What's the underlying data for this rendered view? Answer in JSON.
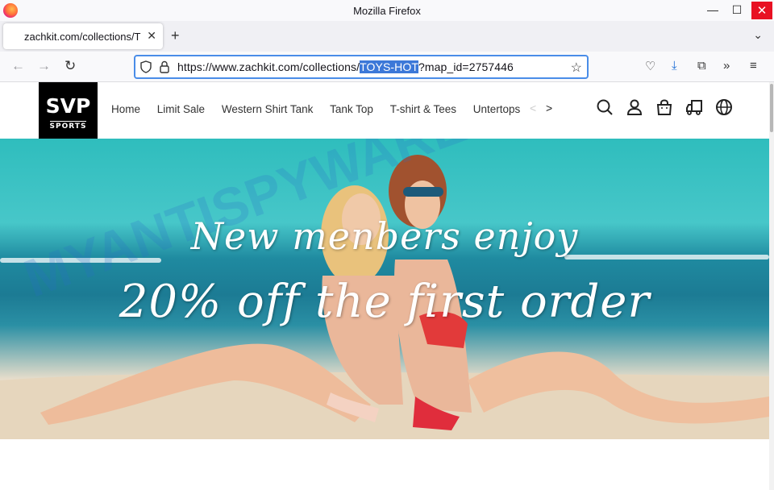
{
  "window": {
    "title": "Mozilla Firefox",
    "minimize": "—",
    "maximize": "☐",
    "close": "✕"
  },
  "tab": {
    "label": "zachkit.com/collections/T",
    "close": "✕",
    "new_tab": "+",
    "list": "⌄"
  },
  "nav": {
    "back": "←",
    "forward": "→",
    "reload": "↻",
    "url_prefix": "https://www.zachkit.com/collections/",
    "url_selected": "TOYS-HOT",
    "url_suffix": "?map_id=2757446",
    "bookmark": "☆"
  },
  "toolbar": {
    "pocket": "♡",
    "download": "⤓",
    "extensions": "⧉",
    "overflow": "»",
    "menu": "≡"
  },
  "site": {
    "logo_main": "SVP",
    "logo_sub": "SPORTS",
    "menu": [
      "Home",
      "Limit Sale",
      "Western Shirt Tank",
      "Tank Top",
      "T-shirt & Tees",
      "Untertops"
    ],
    "menu_prev": "<",
    "menu_next": ">"
  },
  "hero": {
    "line1": "New menbers enjoy",
    "line2": "20% off the first order"
  },
  "watermark": "MYANTISPYWARE.COM",
  "colors": {
    "accent": "#4a8de8",
    "selection": "#3c78d8",
    "close_red": "#e81123",
    "logo_bg": "#000000"
  }
}
